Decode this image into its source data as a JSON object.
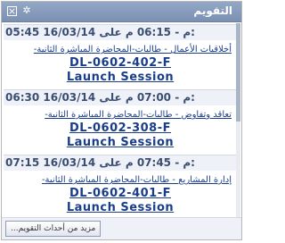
{
  "window": {
    "title": "التقويم",
    "icons": [
      "close-icon",
      "gear-icon"
    ]
  },
  "events": [
    {
      "time": "05:45 م - 06:15 م على 16/03/14:",
      "description": "أخلاقيات الأعمال - طالبات-المحاضرة المباشرة الثانية-",
      "code": "DL-0602-402-F",
      "session": "Launch Session"
    },
    {
      "time": "06:30 م - 07:00 م على 16/03/14:",
      "description": "تعاقد وتفاوض - طالبات-المحاضرة المباشرة الثانية-",
      "code": "DL-0602-308-F",
      "session": "Launch Session"
    },
    {
      "time": "07:15 م - 07:45 م على 16/03/14:",
      "description": "إدارة المشاريع - طالبات-المحاضرة المباشرة الثانية-",
      "code": "DL-0602-401-F",
      "session": "Launch Session"
    }
  ],
  "footer": {
    "more_button": "مزيد من أحداث التقويم..."
  }
}
